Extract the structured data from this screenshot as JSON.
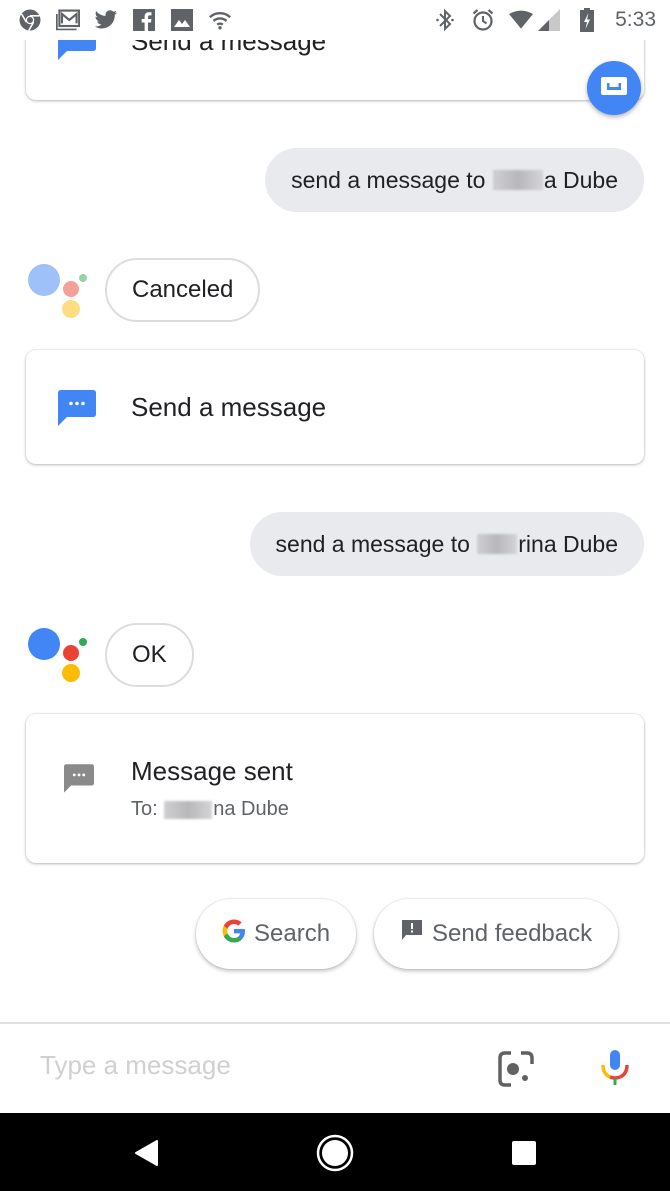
{
  "status_bar": {
    "left_icons": [
      "chrome-icon",
      "gmail-icon",
      "twitter-icon",
      "facebook-icon",
      "gallery-icon",
      "wifi-icon"
    ],
    "right_icons": [
      "bluetooth-icon",
      "alarm-icon",
      "wifi-signal-icon",
      "cell-signal-icon",
      "battery-charging-icon"
    ],
    "time": "5:33"
  },
  "conversation": {
    "top_card": {
      "title": "Send a message",
      "icon": "message-icon",
      "color": "#4285f4"
    },
    "user_query_1": {
      "prefix": "send a message to",
      "suffix": "a Dube"
    },
    "reply_1": {
      "text": "Canceled"
    },
    "card_1": {
      "title": "Send a message",
      "icon": "message-icon",
      "color": "#4285f4"
    },
    "user_query_2": {
      "prefix": "send a message to",
      "suffix": "rina Dube"
    },
    "reply_2": {
      "text": "OK"
    },
    "card_2": {
      "title": "Message sent",
      "to_prefix": "To:",
      "to_suffix": "na Dube",
      "icon": "message-icon",
      "color": "#8a8a8a"
    }
  },
  "suggestion_chips": [
    {
      "label": "Search",
      "icon": "google-g-icon"
    },
    {
      "label": "Send feedback",
      "icon": "feedback-icon"
    }
  ],
  "input_bar": {
    "placeholder": "Type a message",
    "value": ""
  },
  "assistant_colors": {
    "blue": "#4285f4",
    "red": "#ea4335",
    "yellow": "#fbbc05",
    "green": "#34a853"
  },
  "nav": [
    "back-button",
    "home-button",
    "recents-button"
  ]
}
